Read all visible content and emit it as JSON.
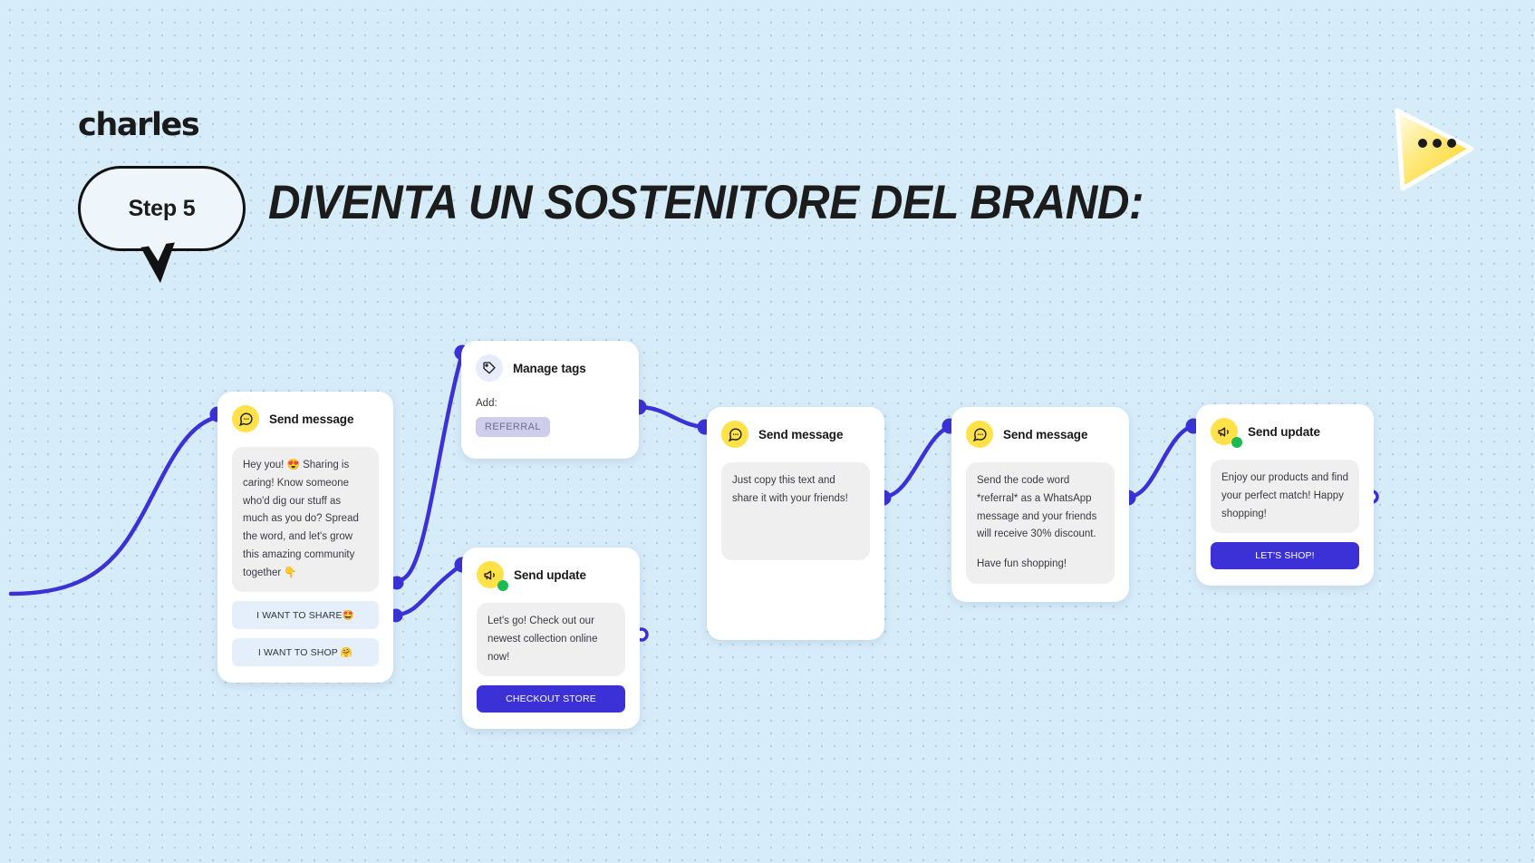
{
  "brand": {
    "logo": "charles"
  },
  "header": {
    "step_badge": "Step 5",
    "headline": "DIVENTA UN SOSTENITORE DEL BRAND:"
  },
  "colors": {
    "background": "#d7ecf9",
    "accent_yellow": "#ffe24a",
    "connector_indigo": "#3b31d6",
    "primary_button": "#3b31d6",
    "light_button": "#e4effb",
    "bubble_gray": "#efeff0",
    "tag_lilac": "#cfcdec",
    "status_green": "#1db954"
  },
  "flow": {
    "cards": [
      {
        "id": "send-message-1",
        "title": "Send message",
        "icon": "chat-bubble-icon",
        "messages": [
          "Hey you! 😍 Sharing is caring! Know someone who'd dig our stuff as much as you do? Spread the word, and let's grow this amazing community together 👇"
        ],
        "buttons": [
          {
            "label": "I WANT TO SHARE🤩",
            "style": "light"
          },
          {
            "label": "I WANT TO SHOP 🤗",
            "style": "light"
          }
        ]
      },
      {
        "id": "manage-tags",
        "title": "Manage tags",
        "icon": "tag-icon",
        "add_label": "Add:",
        "tags": [
          "REFERRAL"
        ]
      },
      {
        "id": "send-update-1",
        "title": "Send update",
        "icon": "megaphone-icon",
        "messages": [
          "Let's go! Check out our newest collection online now!"
        ],
        "buttons": [
          {
            "label": "CHECKOUT STORE",
            "style": "primary"
          }
        ]
      },
      {
        "id": "send-message-2",
        "title": "Send message",
        "icon": "chat-bubble-icon",
        "messages": [
          "Just copy this text and share it with your friends!"
        ],
        "buttons": []
      },
      {
        "id": "send-message-3",
        "title": "Send message",
        "icon": "chat-bubble-icon",
        "messages": [
          "Send the code word *referral* as a WhatsApp message and your friends will receive 30% discount.",
          "Have fun shopping!"
        ],
        "buttons": []
      },
      {
        "id": "send-update-2",
        "title": "Send update",
        "icon": "megaphone-icon",
        "messages": [
          "Enjoy  our products and find your perfect match! Happy shopping!"
        ],
        "buttons": [
          {
            "label": "LET'S SHOP!",
            "style": "primary"
          }
        ]
      }
    ]
  }
}
